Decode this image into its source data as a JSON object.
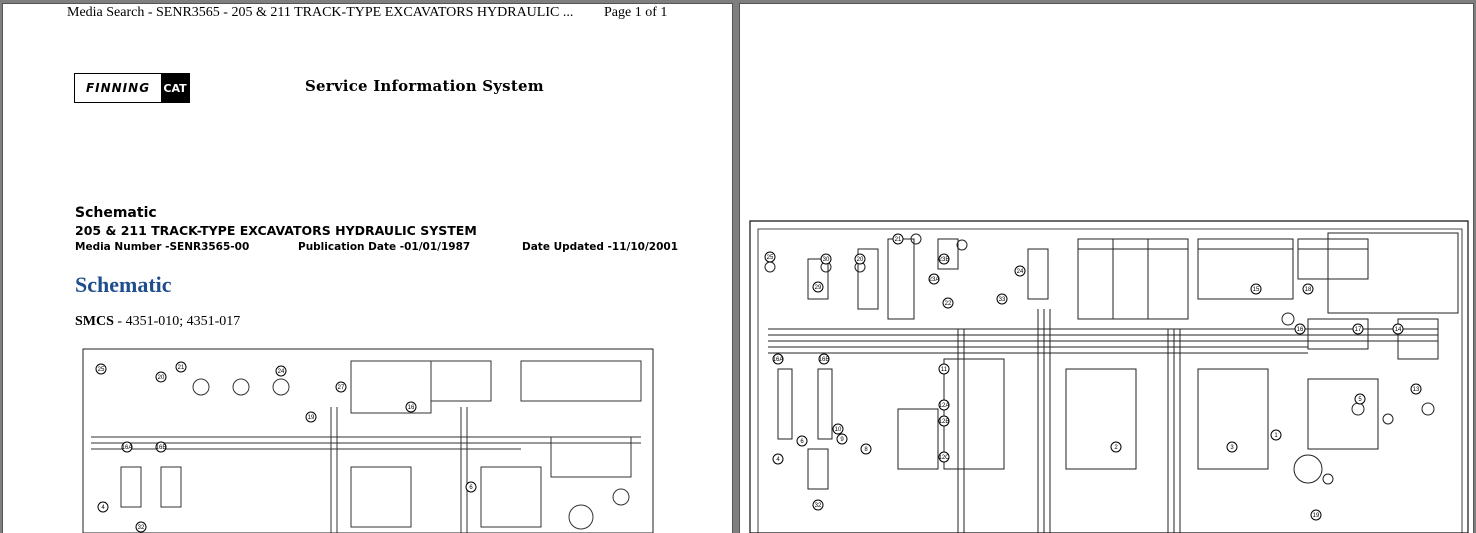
{
  "page1": {
    "header_title": "Media Search - SENR3565 - 205 & 211 TRACK-TYPE EXCAVATORS HYDRAULIC ...",
    "page_indicator": "Page 1 of 1",
    "logo": {
      "left": "FINNING",
      "right": "CAT"
    },
    "system_name": "Service Information System",
    "doc_type": "Schematic",
    "doc_title": "205 & 211 TRACK-TYPE EXCAVATORS HYDRAULIC SYSTEM",
    "media_number": "Media Number -SENR3565-00",
    "publication_date": "Publication Date -01/01/1987",
    "date_updated": "Date Updated -11/10/2001",
    "heading": "Schematic",
    "smcs_label": "SMCS",
    "smcs_value": " - 4351-010; 4351-017"
  },
  "schematic_labels": {
    "page1": [
      "25",
      "20",
      "21",
      "24",
      "27",
      "16",
      "16A",
      "16B",
      "19",
      "6",
      "4",
      "32"
    ],
    "page2": [
      "25",
      "30",
      "29",
      "21",
      "20",
      "23A",
      "23B",
      "22",
      "24",
      "33",
      "15",
      "18",
      "16",
      "17",
      "14",
      "13",
      "16A",
      "16B",
      "11",
      "12A",
      "12B",
      "12C",
      "10",
      "9",
      "8",
      "6",
      "4",
      "32",
      "2",
      "3",
      "1",
      "5",
      "19"
    ]
  },
  "colors": {
    "background": "#7f7f7f",
    "heading_blue": "#1f4e8c"
  }
}
